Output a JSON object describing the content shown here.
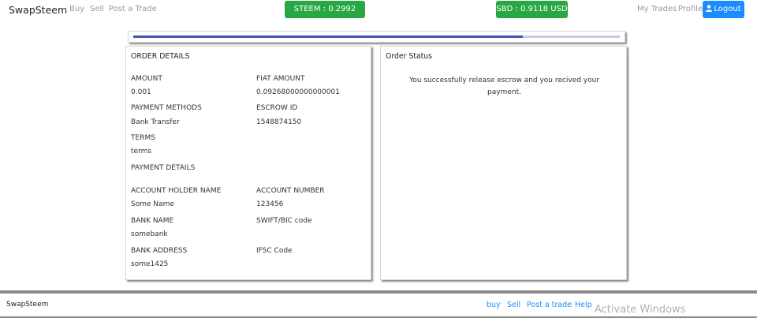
{
  "navbar": {
    "brand": "SwapSteem",
    "links": {
      "buy": "Buy",
      "sell": "Sell",
      "post_trade": "Post a Trade"
    },
    "steem_price": "STEEM : 0.2992 USD",
    "sbd_price": "SBD : 0.9118 USD",
    "my_trades": "My Trades",
    "profile": "Profile",
    "logout": "Logout",
    "colors": {
      "badge": "#28a745",
      "logout": "#1a8cff"
    }
  },
  "progress": {
    "percent": 80
  },
  "order_details": {
    "title": "ORDER DETAILS",
    "amount_label": "AMOUNT",
    "amount": "0.001",
    "fiat_label": "FIAT AMOUNT",
    "fiat": "0.09268000000000001",
    "payment_methods_label": "PAYMENT METHODS",
    "payment_methods": "Bank Transfer",
    "escrow_label": "ESCROW ID",
    "escrow": "1548874150",
    "terms_label": "TERMS",
    "terms": "terms",
    "payment_details_label": "PAYMENT DETAILS",
    "holder_label": "ACCOUNT HOLDER NAME",
    "holder": "Some Name",
    "account_number_label": "ACCOUNT NUMBER",
    "account_number": "123456",
    "bank_name_label": "BANK NAME",
    "bank_name": "somebank",
    "swift_label": "SWIFT/BIC code",
    "bank_address_label": "BANK ADDRESS",
    "bank_address": "some1425",
    "ifsc_label": "IFSC Code"
  },
  "order_status": {
    "title": "Order Status",
    "message": "You successfully release escrow and you recived your payment."
  },
  "footer": {
    "brand": "SwapSteem",
    "links": {
      "buy": "buy",
      "sell": "Sell",
      "post_trade": "Post a trade",
      "help": "Help"
    },
    "watermark": "Activate Windows"
  }
}
